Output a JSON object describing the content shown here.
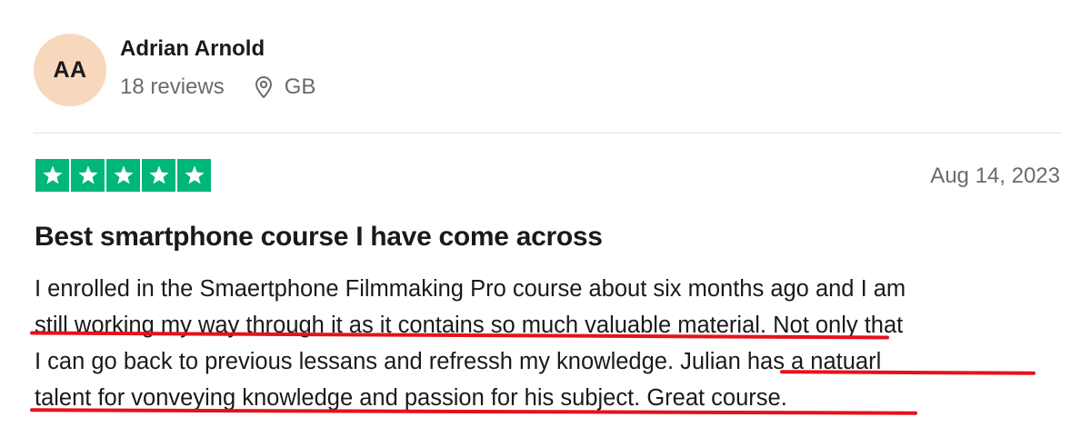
{
  "reviewer": {
    "initials": "AA",
    "name": "Adrian Arnold",
    "review_count": "18 reviews",
    "country": "GB",
    "location_icon": "map-pin-icon"
  },
  "review": {
    "rating": 5,
    "rating_max": 5,
    "star_color": "#00b67a",
    "date": "Aug 14, 2023",
    "title": "Best smartphone course I have come across",
    "body_lines": [
      "I enrolled in the Smaertphone Filmmaking Pro course about six months ago and I am",
      "still working my way through it as it contains so much valuable material. Not only that",
      "I can go back to previous lessans and refressh my knowledge. Julian has a natuarl",
      "talent for vonveying knowledge and passion for his subject. Great course."
    ]
  },
  "colors": {
    "avatar_bg": "#f8d8bd",
    "annotation_underline": "#e5121b"
  }
}
